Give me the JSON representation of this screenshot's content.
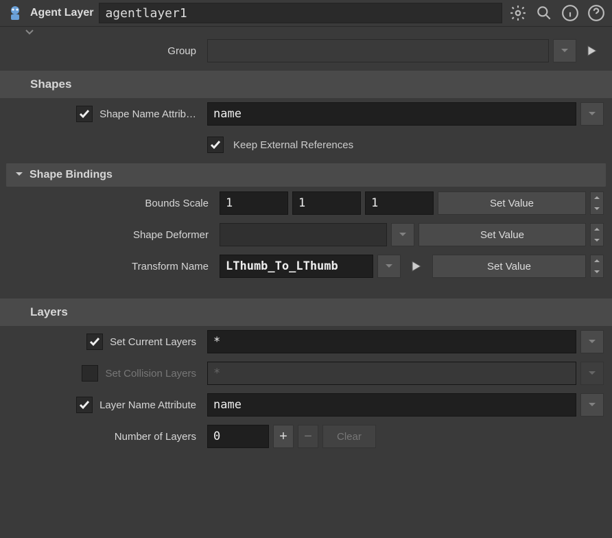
{
  "header": {
    "title": "Agent Layer",
    "name_value": "agentlayer1"
  },
  "group": {
    "label": "Group",
    "value": ""
  },
  "sections": {
    "shapes": {
      "title": "Shapes",
      "shape_name_attr": {
        "label": "Shape Name Attrib…",
        "value": "name",
        "checked": true
      },
      "keep_ext": {
        "label": "Keep External References",
        "checked": true
      },
      "bindings": {
        "title": "Shape Bindings",
        "bounds_scale": {
          "label": "Bounds Scale",
          "x": "1",
          "y": "1",
          "z": "1",
          "action": "Set Value"
        },
        "shape_deformer": {
          "label": "Shape Deformer",
          "value": "",
          "action": "Set Value"
        },
        "transform_name": {
          "label": "Transform Name",
          "value": "LThumb_To_LThumb",
          "action": "Set Value"
        }
      }
    },
    "layers": {
      "title": "Layers",
      "set_current": {
        "label": "Set Current Layers",
        "value": "*",
        "checked": true
      },
      "set_collision": {
        "label": "Set Collision Layers",
        "placeholder": "*",
        "checked": false
      },
      "layer_name_attr": {
        "label": "Layer Name Attribute",
        "value": "name",
        "checked": true
      },
      "num_layers": {
        "label": "Number of Layers",
        "value": "0",
        "clear": "Clear"
      }
    }
  }
}
